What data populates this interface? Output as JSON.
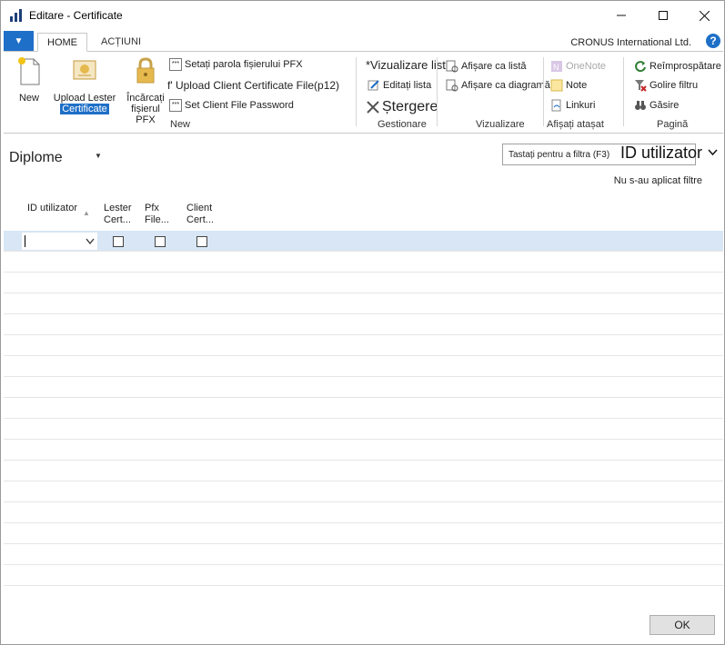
{
  "window": {
    "title": "Editare - Certificate"
  },
  "tabs": {
    "home": "HOME",
    "actions": "ACȚIUNI"
  },
  "company": "CRONUS International Ltd.",
  "ribbon": {
    "new_group": {
      "label": "New",
      "new": "New",
      "upload_lester_1": "Upload Lester",
      "upload_lester_2": "Certificate",
      "incarcati_1": "Încărcați",
      "incarcati_2": "fișierul PFX",
      "set_pfx_password": "Setați parola fișierului PFX",
      "upload_client_cert": "f' Upload Client Certificate File(p12)",
      "set_client_password": "Set Client File Password"
    },
    "gestionare": {
      "label": "Gestionare",
      "vizualizare_lista": "*Vizualizare listă",
      "editati_lista": "Editați lista",
      "stergere": "Ștergere"
    },
    "vizualizare": {
      "label": "Vizualizare",
      "afisare_lista": "Afișare ca listă",
      "afisare_diagrama": "Afișare ca diagramă"
    },
    "atasat": {
      "label": "Afișați atașat",
      "onenote": "OneNote",
      "note": "Note",
      "linkuri": "Linkuri"
    },
    "pagina": {
      "label": "Pagină",
      "reimprospatare": "Reîmprospătare",
      "golire_filtru": "Golire filtru",
      "gasire": "Găsire"
    }
  },
  "page": {
    "title": "Diplome"
  },
  "filter": {
    "placeholder": "Tastați pentru a filtra (F3)",
    "field": "ID utilizator",
    "status": "Nu s-au aplicat filtre"
  },
  "columns": {
    "id_utilizator": "ID utilizator",
    "lester_1": "Lester",
    "lester_2": "Cert...",
    "pfx_1": "Pfx",
    "pfx_2": "File...",
    "client_1": "Client",
    "client_2": "Cert..."
  },
  "ok_label": "OK",
  "colors": {
    "accent": "#1e6fc7",
    "selected_row": "#d8e6f5"
  }
}
